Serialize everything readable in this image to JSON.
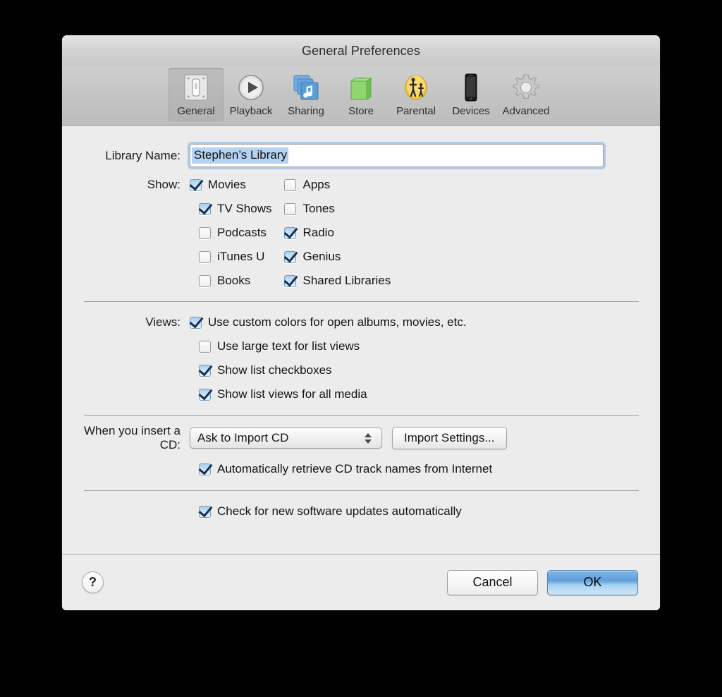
{
  "window": {
    "title": "General Preferences"
  },
  "toolbar": {
    "tabs": [
      {
        "label": "General",
        "icon": "toggle-switch-icon",
        "selected": true
      },
      {
        "label": "Playback",
        "icon": "play-circle-icon",
        "selected": false
      },
      {
        "label": "Sharing",
        "icon": "music-stack-icon",
        "selected": false
      },
      {
        "label": "Store",
        "icon": "shopping-bag-icon",
        "selected": false
      },
      {
        "label": "Parental",
        "icon": "parental-icon",
        "selected": false
      },
      {
        "label": "Devices",
        "icon": "iphone-icon",
        "selected": false
      },
      {
        "label": "Advanced",
        "icon": "gear-icon",
        "selected": false
      }
    ]
  },
  "library": {
    "label": "Library Name:",
    "value": "Stephen’s Library",
    "placeholder": "Library Name",
    "selected": true
  },
  "show": {
    "label": "Show:",
    "left": [
      {
        "label": "Movies",
        "checked": true
      },
      {
        "label": "TV Shows",
        "checked": true
      },
      {
        "label": "Podcasts",
        "checked": false
      },
      {
        "label": "iTunes U",
        "checked": false
      },
      {
        "label": "Books",
        "checked": false
      }
    ],
    "right": [
      {
        "label": "Apps",
        "checked": false
      },
      {
        "label": "Tones",
        "checked": false
      },
      {
        "label": "Radio",
        "checked": true
      },
      {
        "label": "Genius",
        "checked": true
      },
      {
        "label": "Shared Libraries",
        "checked": true
      }
    ]
  },
  "views": {
    "label": "Views:",
    "items": [
      {
        "label": "Use custom colors for open albums, movies, etc.",
        "checked": true
      },
      {
        "label": "Use large text for list views",
        "checked": false
      },
      {
        "label": "Show list checkboxes",
        "checked": true
      },
      {
        "label": "Show list views for all media",
        "checked": true
      }
    ]
  },
  "cd": {
    "label": "When you insert a CD:",
    "popup_value": "Ask to Import CD",
    "popup_options": [
      "Ask to Import CD"
    ],
    "import_settings_label": "Import Settings...",
    "auto_retrieve": {
      "label": "Automatically retrieve CD track names from Internet",
      "checked": true
    }
  },
  "updates": {
    "label": "Check for new software updates automatically",
    "checked": true
  },
  "footer": {
    "help_label": "?",
    "cancel_label": "Cancel",
    "ok_label": "OK"
  },
  "colors": {
    "accent_blue": "#5fa0dc",
    "selection_blue": "#b5d2f0",
    "checkmark": "#1a2f4e",
    "window_bg": "#ececec"
  }
}
